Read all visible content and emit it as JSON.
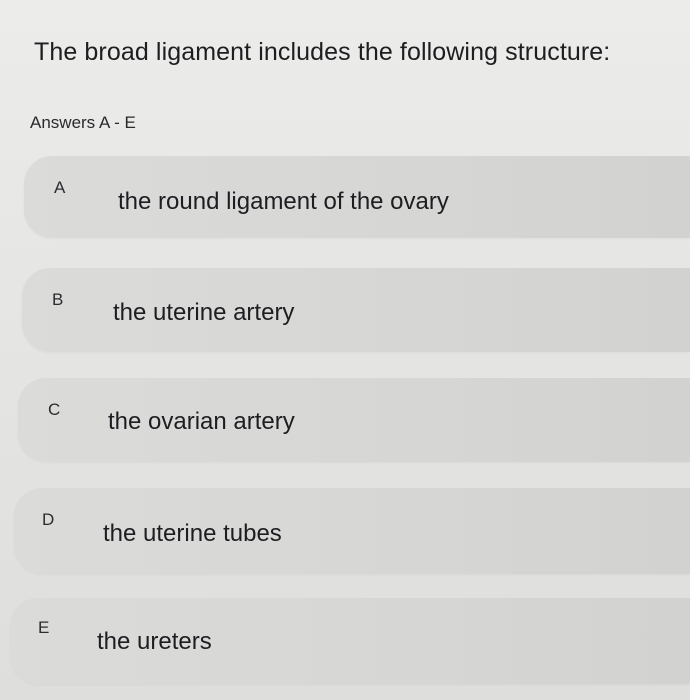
{
  "question": {
    "text": "The broad ligament includes the following structure:"
  },
  "answers_label": "Answers A - E",
  "options": [
    {
      "letter": "A",
      "text": "the round ligament of the ovary"
    },
    {
      "letter": "B",
      "text": "the uterine artery"
    },
    {
      "letter": "C",
      "text": "the ovarian artery"
    },
    {
      "letter": "D",
      "text": "the uterine tubes"
    },
    {
      "letter": "E",
      "text": "the ureters"
    }
  ],
  "colors": {
    "background": "#e6e6e4",
    "option_background": "#d7d7d5",
    "text": "#1f1f22"
  }
}
